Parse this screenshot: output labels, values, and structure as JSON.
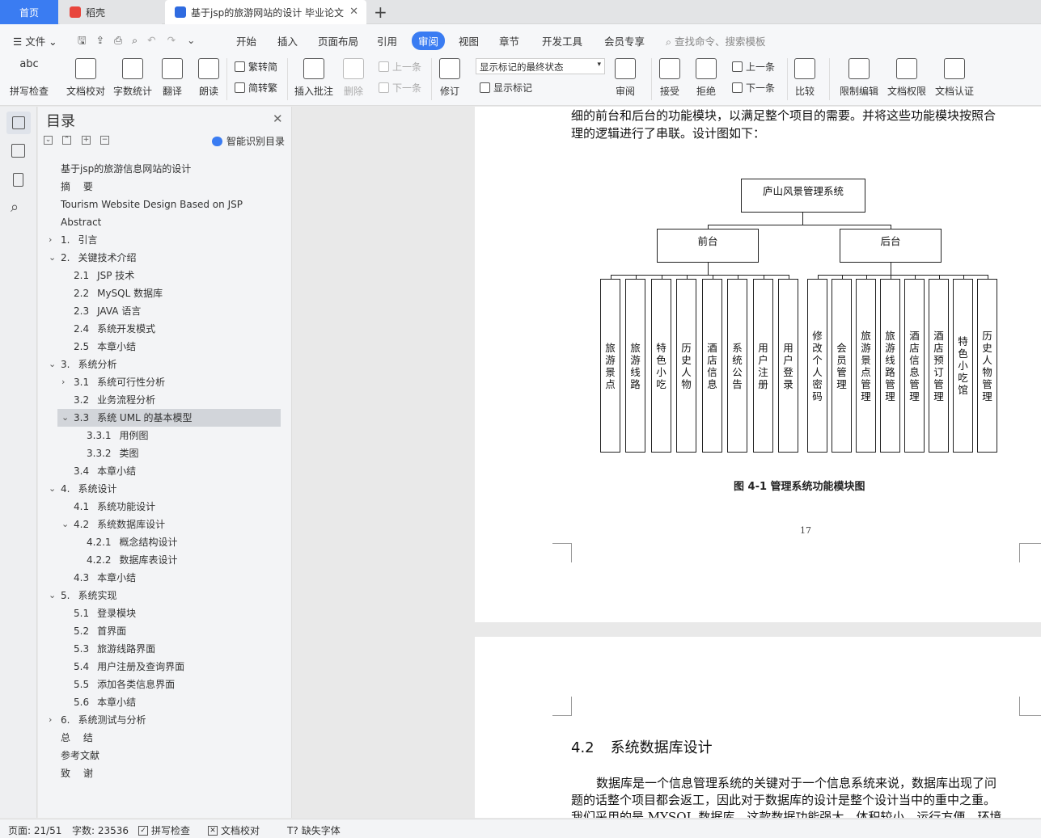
{
  "tabs": {
    "home": "首页",
    "daoke": "稻壳",
    "doc": "基于jsp的旅游网站的设计 毕业论文",
    "add": "+"
  },
  "menu": {
    "file": "文件",
    "items": [
      "开始",
      "插入",
      "页面布局",
      "引用",
      "审阅",
      "视图",
      "章节",
      "开发工具",
      "会员专享"
    ],
    "search": "查找命令、搜索模板"
  },
  "ribbon": {
    "spell": "拼写检查",
    "proof": "文档校对",
    "wordcount": "字数统计",
    "translate": "翻译",
    "read": "朗读",
    "to_trad": "繁转简",
    "to_simp": "简转繁",
    "insert_comment": "插入批注",
    "delete": "删除",
    "prev": "上一条",
    "next": "下一条",
    "track": "修订",
    "markup_state": "显示标记的最终状态",
    "show_markup": "显示标记",
    "review": "审阅",
    "accept": "接受",
    "reject": "拒绝",
    "prev2": "上一条",
    "next2": "下一条",
    "compare": "比较",
    "restrict": "限制编辑",
    "permission": "文档权限",
    "certify": "文档认证"
  },
  "toc": {
    "title": "目录",
    "smart": "智能识别目录",
    "items": [
      {
        "num": "",
        "text": "基于jsp的旅游信息网站的设计"
      },
      {
        "num": "",
        "text": "摘　 要"
      },
      {
        "num": "",
        "text": "Tourism Website Design Based on JSP"
      },
      {
        "num": "",
        "text": "Abstract"
      },
      {
        "num": "1.",
        "text": "引言"
      },
      {
        "num": "2.",
        "text": "关键技术介绍"
      },
      {
        "num": "2.1",
        "text": "JSP 技术"
      },
      {
        "num": "2.2",
        "text": "MySQL 数据库"
      },
      {
        "num": "2.3",
        "text": "JAVA 语言"
      },
      {
        "num": "2.4",
        "text": "系统开发模式"
      },
      {
        "num": "2.5",
        "text": "本章小结"
      },
      {
        "num": "3.",
        "text": "系统分析"
      },
      {
        "num": "3.1",
        "text": "系统可行性分析"
      },
      {
        "num": "3.2",
        "text": "业务流程分析"
      },
      {
        "num": "3.3",
        "text": "系统 UML 的基本模型"
      },
      {
        "num": "3.3.1",
        "text": "用例图"
      },
      {
        "num": "3.3.2",
        "text": "类图"
      },
      {
        "num": "3.4",
        "text": "本章小结"
      },
      {
        "num": "4.",
        "text": "系统设计"
      },
      {
        "num": "4.1",
        "text": "系统功能设计"
      },
      {
        "num": "4.2",
        "text": "系统数据库设计"
      },
      {
        "num": "4.2.1",
        "text": "概念结构设计"
      },
      {
        "num": "4.2.2",
        "text": "数据库表设计"
      },
      {
        "num": "4.3",
        "text": "本章小结"
      },
      {
        "num": "5.",
        "text": "系统实现"
      },
      {
        "num": "5.1",
        "text": "登录模块"
      },
      {
        "num": "5.2",
        "text": "首界面"
      },
      {
        "num": "5.3",
        "text": "旅游线路界面"
      },
      {
        "num": "5.4",
        "text": "用户注册及查询界面"
      },
      {
        "num": "5.5",
        "text": "添加各类信息界面"
      },
      {
        "num": "5.6",
        "text": "本章小结"
      },
      {
        "num": "6.",
        "text": "系统测试与分析"
      },
      {
        "num": "",
        "text": "总　 结"
      },
      {
        "num": "",
        "text": "参考文献"
      },
      {
        "num": "",
        "text": "致　 谢"
      }
    ]
  },
  "doc": {
    "para1_line1": "细的前台和后台的功能模块，以满足整个项目的需要。并将这些功能模块按照合",
    "para1_line2": "理的逻辑进行了串联。设计图如下：",
    "diagram": {
      "root": "庐山风景管理系统",
      "front": "前台",
      "back": "后台",
      "front_leaves": [
        "旅游景点",
        "旅游线路",
        "特色小吃",
        "历史人物",
        "酒店信息",
        "系统公告",
        "用户注册",
        "用户登录"
      ],
      "back_leaves": [
        "修改个人密码",
        "会员管理",
        "旅游景点管理",
        "旅游线路管理",
        "酒店信息管理",
        "酒店预订管理",
        "特色小吃馆",
        "历史人物管理"
      ]
    },
    "caption": "图 4-1 管理系统功能模块图",
    "page_number": "17",
    "heading_num": "4.2",
    "heading_text": "系统数据库设计",
    "para2_line1": "数据库是一个信息管理系统的关键对于一个信息系统来说，数据库出现了问",
    "para2_line2": "题的话整个项目都会返工，因此对于数据库的设计是整个设计当中的重中之重。",
    "para2_line3": "我们采用的是 MYSQL 数据库，这款数据功能强大，体积较小，运行方便，环境"
  },
  "status": {
    "page": "页面: 21/51",
    "words": "字数: 23536",
    "spell": "拼写检查",
    "proof": "文档校对",
    "font": "缺失字体"
  },
  "colors": {
    "accent": "#3a7cf2",
    "wps_red": "#e8453c",
    "doc_blue": "#2f6be0"
  }
}
